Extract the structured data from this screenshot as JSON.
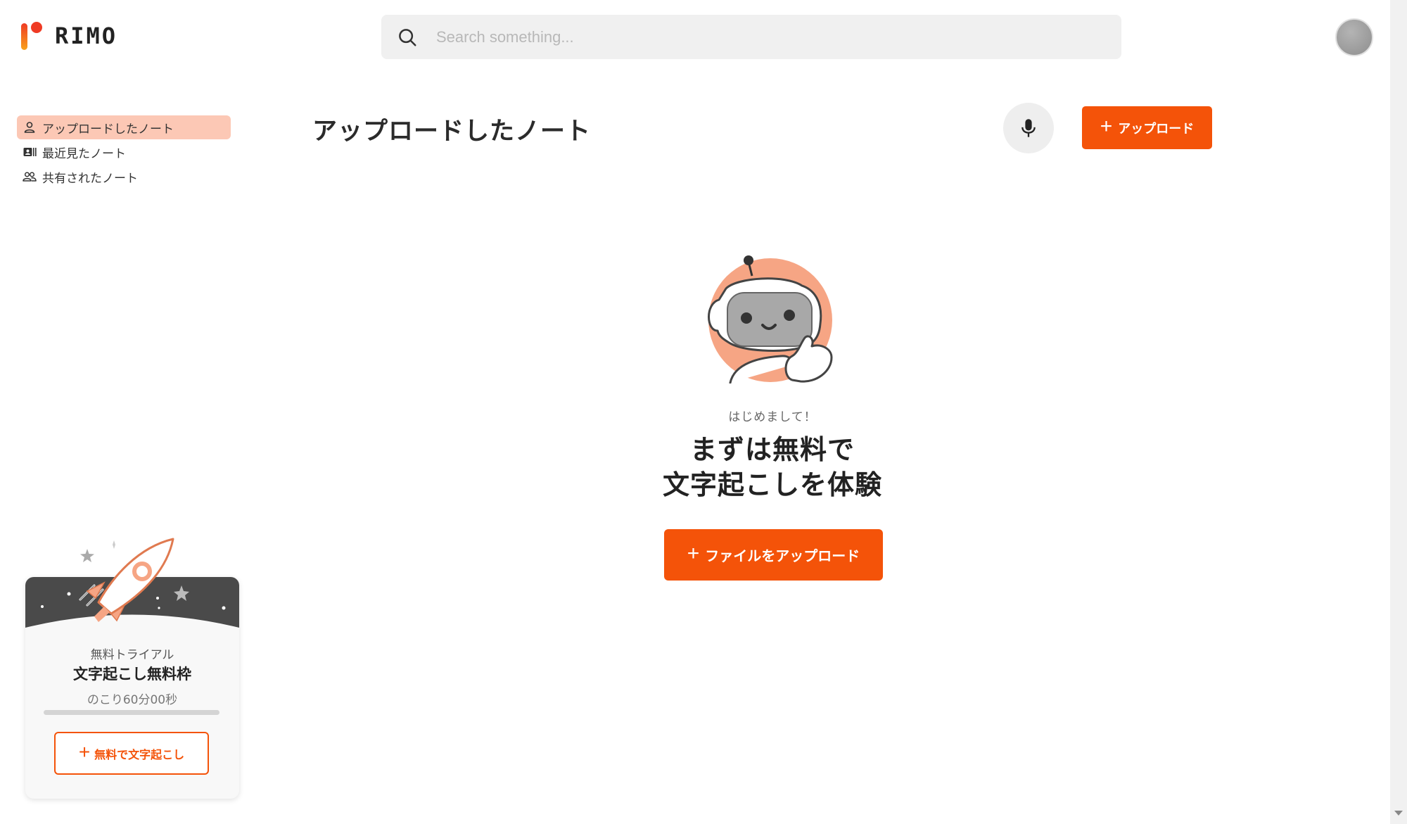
{
  "app": {
    "logo_text": "RIMO"
  },
  "search": {
    "placeholder": "Search something..."
  },
  "sidebar": {
    "items": [
      {
        "label": "アップロードしたノート",
        "icon": "person-icon",
        "active": true
      },
      {
        "label": "最近見たノート",
        "icon": "contact-card-icon",
        "active": false
      },
      {
        "label": "共有されたノート",
        "icon": "people-icon",
        "active": false
      }
    ]
  },
  "main": {
    "title": "アップロードしたノート",
    "upload_label": "アップロード",
    "mic_icon": "microphone-icon"
  },
  "empty_state": {
    "greeting": "はじめまして！",
    "headline_line1": "まずは無料で",
    "headline_line2": "文字起こしを体験",
    "button_label": "ファイルをアップロード"
  },
  "trial": {
    "label": "無料トライアル",
    "title": "文字起こし無料枠",
    "remaining": "のこり60分00秒",
    "remaining_fraction": 1.0,
    "button_label": "無料で文字起こし"
  },
  "colors": {
    "accent": "#f45309",
    "active_nav": "#fcc8b5",
    "robot_circle": "#f6a584"
  }
}
